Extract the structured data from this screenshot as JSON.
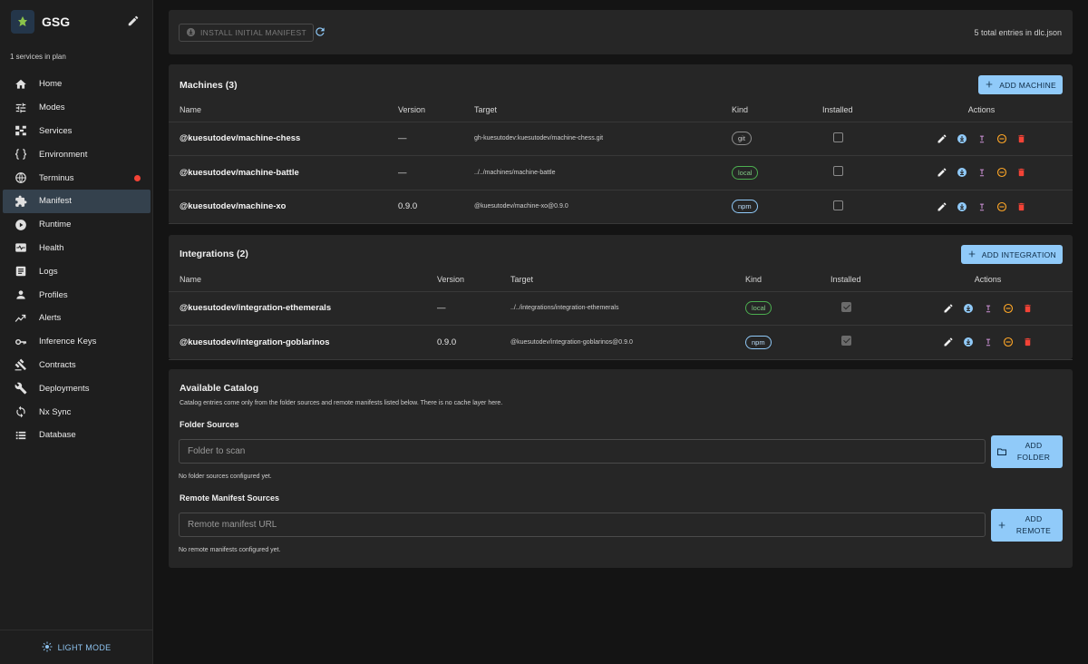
{
  "app": {
    "name": "GSG",
    "subtitle": "1 services in plan",
    "mode_toggle": "LIGHT MODE"
  },
  "nav": [
    {
      "label": "Home",
      "icon": "home-icon"
    },
    {
      "label": "Modes",
      "icon": "tune-icon"
    },
    {
      "label": "Services",
      "icon": "services-icon"
    },
    {
      "label": "Environment",
      "icon": "braces-icon"
    },
    {
      "label": "Terminus",
      "icon": "globe-icon",
      "alert": true
    },
    {
      "label": "Manifest",
      "icon": "puzzle-icon",
      "active": true
    },
    {
      "label": "Runtime",
      "icon": "play-icon"
    },
    {
      "label": "Health",
      "icon": "monitor-heart-icon"
    },
    {
      "label": "Logs",
      "icon": "article-icon"
    },
    {
      "label": "Profiles",
      "icon": "person-icon"
    },
    {
      "label": "Alerts",
      "icon": "trend-icon"
    },
    {
      "label": "Inference Keys",
      "icon": "key-icon"
    },
    {
      "label": "Contracts",
      "icon": "gavel-icon"
    },
    {
      "label": "Deployments",
      "icon": "wrench-icon"
    },
    {
      "label": "Nx Sync",
      "icon": "sync-icon"
    },
    {
      "label": "Database",
      "icon": "list-icon"
    }
  ],
  "toolbar": {
    "install_label": "INSTALL INITIAL MANIFEST",
    "total_entries": "5 total entries in dlc.json"
  },
  "machines": {
    "title": "Machines (3)",
    "add_label": "ADD MACHINE",
    "columns": [
      "Name",
      "Version",
      "Target",
      "Kind",
      "Installed",
      "Actions"
    ],
    "rows": [
      {
        "name": "@kuesutodev/machine-chess",
        "version": "—",
        "target": "gh-kuesutodev:kuesutodev/machine-chess.git",
        "kind": "git",
        "installed": false
      },
      {
        "name": "@kuesutodev/machine-battle",
        "version": "—",
        "target": "../../machines/machine-battle",
        "kind": "local",
        "installed": false
      },
      {
        "name": "@kuesutodev/machine-xo",
        "version": "0.9.0",
        "target": "@kuesutodev/machine-xo@0.9.0",
        "kind": "npm",
        "installed": false
      }
    ]
  },
  "integrations": {
    "title": "Integrations (2)",
    "add_label": "ADD INTEGRATION",
    "columns": [
      "Name",
      "Version",
      "Target",
      "Kind",
      "Installed",
      "Actions"
    ],
    "rows": [
      {
        "name": "@kuesutodev/integration-ethemerals",
        "version": "—",
        "target": "../../integrations/integration-ethemerals",
        "kind": "local",
        "installed": true
      },
      {
        "name": "@kuesutodev/integration-goblarinos",
        "version": "0.9.0",
        "target": "@kuesutodev/integration-goblarinos@0.9.0",
        "kind": "npm",
        "installed": true
      }
    ]
  },
  "catalog": {
    "title": "Available Catalog",
    "description": "Catalog entries come only from the folder sources and remote manifests listed below. There is no cache layer here.",
    "folder": {
      "title": "Folder Sources",
      "placeholder": "Folder to scan",
      "button_line1": "ADD",
      "button_line2": "FOLDER",
      "empty": "No folder sources configured yet."
    },
    "remote": {
      "title": "Remote Manifest Sources",
      "placeholder": "Remote manifest URL",
      "button_line1": "ADD",
      "button_line2": "REMOTE",
      "empty": "No remote manifests configured yet."
    }
  },
  "colors": {
    "accent": "#90caf9",
    "alert_dot": "#f44336",
    "delete": "#f44336",
    "remove": "#ffa726",
    "upload": "#ce93d8",
    "git": "#8d8d8d",
    "local": "#4caf50",
    "npm": "#90caf9"
  }
}
